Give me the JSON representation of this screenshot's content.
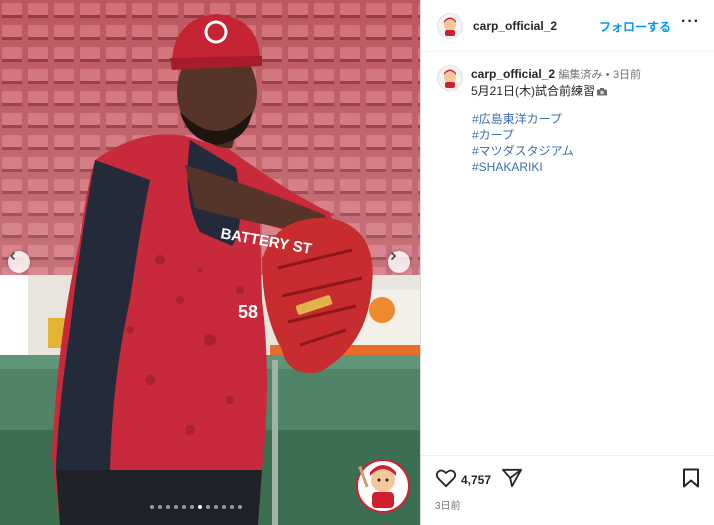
{
  "post": {
    "username": "carp_official_2",
    "follow_label": "フォローする",
    "more_label": "···",
    "edited_label": "編集済み",
    "separator": "•",
    "time_ago": "3日前",
    "caption_text": "5月21日(木)試合前練習",
    "hashtags": [
      "#広島東洋カープ",
      "#カープ",
      "#マツダスタジアム",
      "#SHAKARIKI"
    ],
    "like_count": "4,757",
    "timestamp": "3日前"
  },
  "photo": {
    "jersey_text": "BATTERY ST",
    "jersey_number": "58",
    "carousel_total": 12,
    "carousel_active": 6
  },
  "colors": {
    "accent": "#0095f6",
    "hashtag": "#3b6fb3",
    "carp_red": "#d0202f"
  },
  "icons": {
    "prev": "chevron-left-icon",
    "next": "chevron-right-icon",
    "like": "heart-icon",
    "share": "paper-plane-icon",
    "save": "bookmark-icon"
  }
}
